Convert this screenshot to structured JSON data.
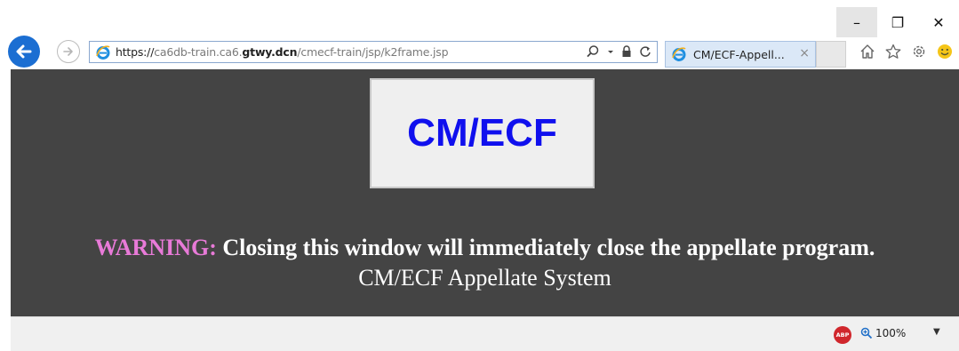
{
  "window": {
    "minimize_glyph": "–",
    "restore_glyph": "❐",
    "close_glyph": "✕"
  },
  "address_bar": {
    "scheme": "https://",
    "host_prefix": "ca6db-train.ca6.",
    "host_domain": "gtwy.dcn",
    "path": "/cmecf-train/jsp/k2frame.jsp"
  },
  "tab": {
    "title": "CM/ECF-Appell...",
    "close_glyph": "×"
  },
  "content": {
    "logo_text": "CM/ECF",
    "warning_label": "WARNING:",
    "warning_text": " Closing this window will immediately close the appellate program.",
    "system_name": "CM/ECF Appellate System"
  },
  "status_bar": {
    "adblock_label": "ABP",
    "zoom_level": "100%",
    "zoom_caret": "▼"
  },
  "colors": {
    "content_bg": "#444444",
    "logo_text": "#1010ee",
    "warning_label": "#e87ad8",
    "back_button": "#1b6ed2"
  },
  "icons": [
    "back-arrow-icon",
    "forward-arrow-icon",
    "ie-logo-icon",
    "search-icon",
    "dropdown-icon",
    "lock-icon",
    "refresh-icon",
    "home-icon",
    "favorites-star-icon",
    "settings-gear-icon",
    "smiley-feedback-icon",
    "adblock-icon",
    "zoom-magnifier-icon"
  ]
}
